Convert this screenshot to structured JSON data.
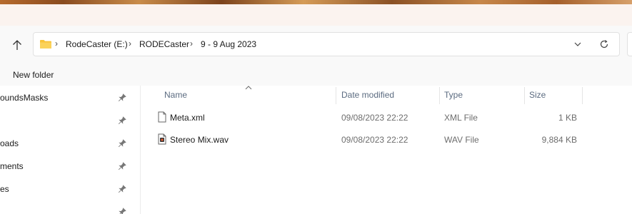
{
  "address_bar": {
    "crumbs": [
      "RodeCaster (E:)",
      "RODECaster",
      "9 - 9 Aug 2023"
    ]
  },
  "command_bar": {
    "new_folder_label": "New folder"
  },
  "sidebar": {
    "items": [
      {
        "label": "oundsMasks"
      },
      {
        "label": ""
      },
      {
        "label": "oads"
      },
      {
        "label": "ments"
      },
      {
        "label": "es"
      },
      {
        "label": ""
      }
    ]
  },
  "file_list": {
    "columns": [
      "Name",
      "Date modified",
      "Type",
      "Size"
    ],
    "rows": [
      {
        "name": "Meta.xml",
        "date": "09/08/2023 22:22",
        "type": "XML File",
        "size": "1 KB",
        "icon": "xml-file-icon"
      },
      {
        "name": "Stereo Mix.wav",
        "date": "09/08/2023 22:22",
        "type": "WAV File",
        "size": "9,884 KB",
        "icon": "audio-file-icon"
      }
    ]
  },
  "colors": {
    "folder_yellow": "#f8c33a",
    "header_text": "#5b6b80"
  }
}
